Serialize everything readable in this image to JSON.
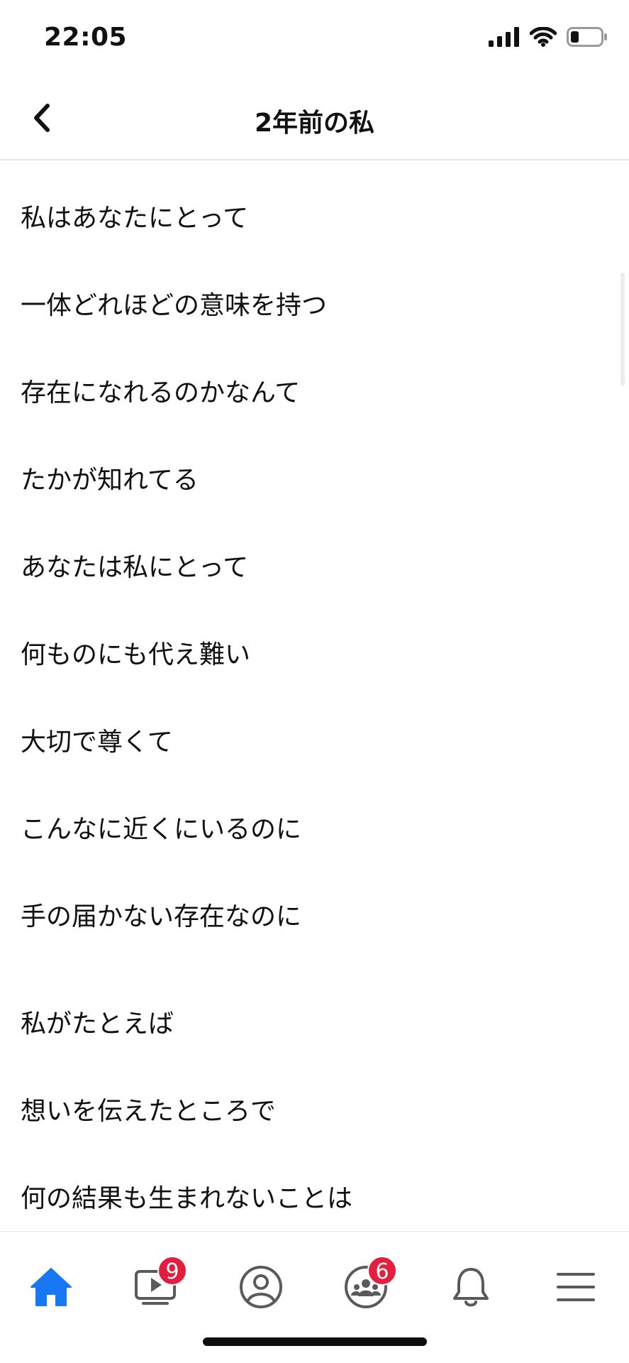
{
  "status": {
    "time": "22:05"
  },
  "header": {
    "title": "2年前の私"
  },
  "lyrics": [
    "私はあなたにとって",
    "一体どれほどの意味を持つ",
    "存在になれるのかなんて",
    "たかが知れてる",
    "あなたは私にとって",
    "何ものにも代え難い",
    "大切で尊くて",
    "こんなに近くにいるのに",
    "手の届かない存在なのに",
    "私がたとえば",
    "想いを伝えたところで",
    "何の結果も生まれないことは"
  ],
  "tabbar": {
    "items": [
      {
        "icon": "home-icon",
        "active": true
      },
      {
        "icon": "video-icon",
        "badge": "9"
      },
      {
        "icon": "profile-icon"
      },
      {
        "icon": "groups-icon",
        "badge": "6"
      },
      {
        "icon": "bell-icon"
      },
      {
        "icon": "menu-icon"
      }
    ]
  },
  "colors": {
    "accent": "#1877f2",
    "badge": "#e41e3f",
    "icon": "#5a5a5a"
  }
}
